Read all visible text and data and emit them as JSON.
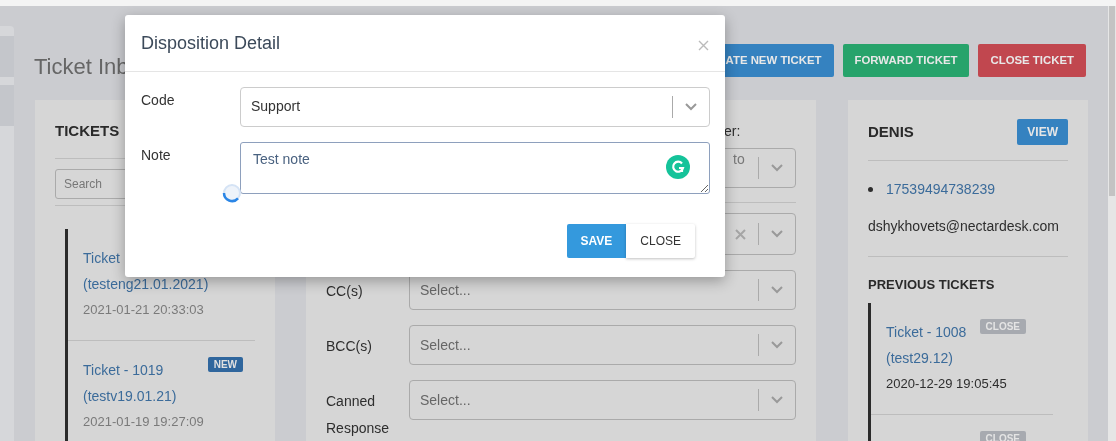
{
  "page": {
    "title": "Ticket Inb",
    "actions": [
      {
        "label": "ATE NEW TICKET",
        "kind": "primary"
      },
      {
        "label": "FORWARD TICKET",
        "kind": "success"
      },
      {
        "label": "CLOSE TICKET",
        "kind": "danger"
      }
    ]
  },
  "tickets_panel": {
    "heading": "TICKETS",
    "search": {
      "placeholder": "Search"
    },
    "items": [
      {
        "title": "Ticket",
        "subject": "(testeng21.01.2021)",
        "time": "2021-01-21 20:33:03"
      },
      {
        "title": "Ticket - 1019",
        "badge": "NEW",
        "subject": "(testv19.01.21)",
        "time": "2021-01-19 19:27:09"
      }
    ]
  },
  "form_panel": {
    "top_field": {
      "label": "er:",
      "placeholder": "to"
    },
    "fields": [
      {
        "clearable": true
      },
      {
        "label": "CC(s)",
        "placeholder": "Select...",
        "clearable": false
      },
      {
        "label": "BCC(s)",
        "placeholder": "Select...",
        "clearable": false
      },
      {
        "label": "Canned Response",
        "placeholder": "Select...",
        "clearable": false
      }
    ]
  },
  "contact": {
    "name": "DENIS",
    "view_button": "VIEW",
    "phones": [
      "17539494738239"
    ],
    "email": "dshykhovets@nectardesk.com",
    "previous_heading": "PREVIOUS TICKETS",
    "previous": [
      {
        "title": "Ticket - 1008",
        "badge": "CLOSE",
        "subject": "(test29.12)",
        "time": "2020-12-29 19:05:45"
      },
      {
        "badge": "CLOSE"
      }
    ]
  },
  "modal": {
    "title": "Disposition Detail",
    "fields": [
      {
        "label": "Code",
        "kind": "select",
        "value": "Support"
      },
      {
        "label": "Note",
        "kind": "textarea",
        "value": "Test note"
      }
    ],
    "buttons": [
      {
        "label": "SAVE",
        "kind": "primary"
      },
      {
        "label": "CLOSE",
        "kind": "default"
      }
    ]
  }
}
